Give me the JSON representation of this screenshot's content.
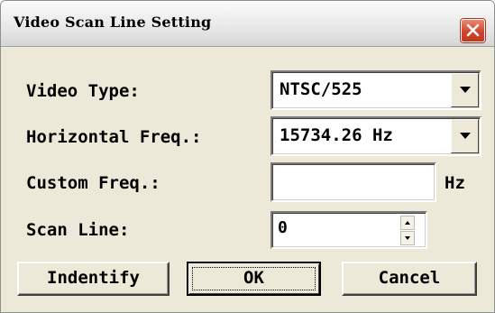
{
  "window": {
    "title": "Video Scan Line Setting",
    "close_icon": "close-icon"
  },
  "form": {
    "video_type": {
      "label": "Video Type:",
      "value": "NTSC/525",
      "icon": "chevron-down-icon"
    },
    "horizontal_freq": {
      "label": "Horizontal Freq.:",
      "value": "15734.26 Hz",
      "icon": "chevron-down-icon"
    },
    "custom_freq": {
      "label": "Custom Freq.:",
      "value": "",
      "unit": "Hz"
    },
    "scan_line": {
      "label": "Scan Line:",
      "value": "0"
    }
  },
  "buttons": {
    "identify": "Indentify",
    "ok": "OK",
    "cancel": "Cancel"
  },
  "colors": {
    "dialog_bg": "#ece9d8",
    "close_button": "#d2452b",
    "field_bg": "#ffffff"
  }
}
